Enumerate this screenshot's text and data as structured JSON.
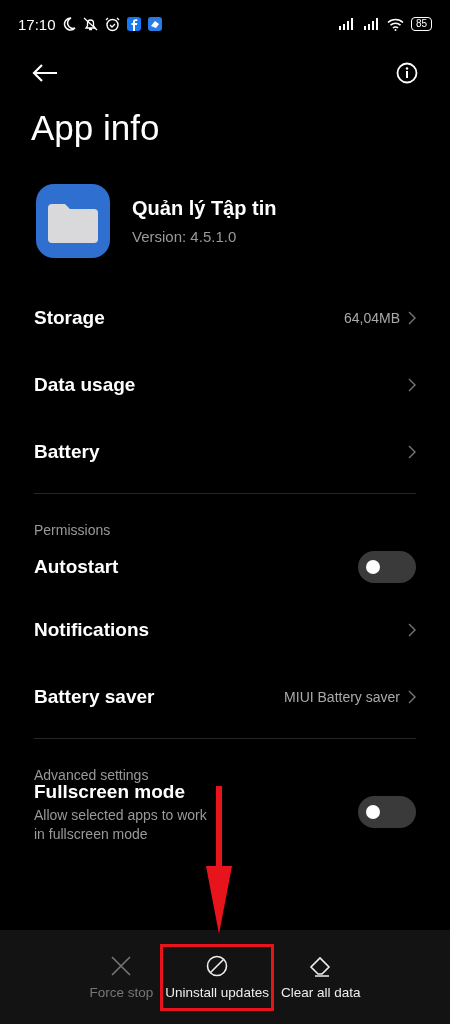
{
  "status_bar": {
    "time": "17:10",
    "battery": "85"
  },
  "title": "App info",
  "app": {
    "name": "Quản lý Tập tin",
    "version": "Version: 4.5.1.0"
  },
  "rows": [
    {
      "kind": "link",
      "label": "Storage",
      "value": "64,04MB"
    },
    {
      "kind": "link",
      "label": "Data usage"
    },
    {
      "kind": "link",
      "label": "Battery"
    }
  ],
  "permissions": {
    "heading": "Permissions",
    "rows": [
      {
        "kind": "toggle",
        "label": "Autostart",
        "on": false
      },
      {
        "kind": "link",
        "label": "Notifications"
      },
      {
        "kind": "link",
        "label": "Battery saver",
        "value": "MIUI Battery saver"
      }
    ]
  },
  "advanced": {
    "heading": "Advanced settings",
    "rows": [
      {
        "kind": "toggle",
        "label": "Fullscreen mode",
        "description": "Allow selected apps to work in fullscreen mode",
        "on": false
      }
    ]
  },
  "actions": [
    {
      "kind": "stop",
      "label": "Force stop",
      "disabled": true,
      "highlighted": false
    },
    {
      "kind": "uninstall",
      "label": "Uninstall updates",
      "disabled": false,
      "highlighted": true
    },
    {
      "kind": "clear",
      "label": "Clear all data",
      "disabled": false,
      "highlighted": false
    }
  ]
}
